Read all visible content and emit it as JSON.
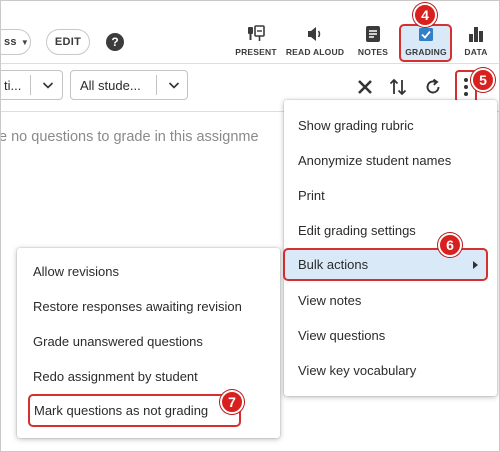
{
  "topbar": {
    "class_selector": "ss",
    "edit_label": "EDIT",
    "help_symbol": "?",
    "tools": [
      {
        "label": "PRESENT",
        "icon": "present-icon"
      },
      {
        "label": "READ ALOUD",
        "icon": "speaker-icon"
      },
      {
        "label": "NOTES",
        "icon": "notes-icon"
      },
      {
        "label": "GRADING",
        "icon": "grading-icon",
        "active": true
      },
      {
        "label": "DATA",
        "icon": "bar-chart-icon"
      }
    ]
  },
  "filters": {
    "filter_one_value": "ti...",
    "filter_two_value": "All stude..."
  },
  "main": {
    "empty_message": "e no questions to grade in this assignme"
  },
  "menu": {
    "items": [
      {
        "label": "Show grading rubric"
      },
      {
        "label": "Anonymize student names"
      },
      {
        "label": "Print"
      },
      {
        "label": "Edit grading settings"
      },
      {
        "label": "Bulk actions",
        "has_submenu": true
      },
      {
        "label": "View notes"
      },
      {
        "label": "View questions"
      },
      {
        "label": "View key vocabulary"
      }
    ]
  },
  "submenu": {
    "items": [
      {
        "label": "Allow revisions"
      },
      {
        "label": "Restore responses awaiting revision"
      },
      {
        "label": "Grade unanswered questions"
      },
      {
        "label": "Redo assignment by student"
      },
      {
        "label": "Mark questions as not grading"
      }
    ]
  },
  "callouts": [
    "4",
    "5",
    "6",
    "7"
  ],
  "colors": {
    "callout_red": "#d8201f",
    "highlight_blue": "#d9e9f8",
    "grading_blue": "#2f7fc9",
    "text": "#2b2b2b"
  }
}
